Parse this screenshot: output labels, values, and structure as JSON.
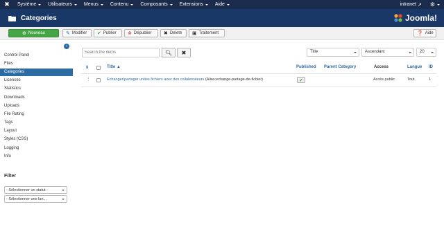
{
  "navbar": {
    "logo": "joomla-icon",
    "menus": [
      "Système",
      "Utilisateurs",
      "Menus",
      "Contenu",
      "Composants",
      "Extensions",
      "Aide"
    ],
    "right": {
      "user": "intranet",
      "settings_icon": "gear-icon"
    }
  },
  "header": {
    "title": "Categories",
    "brand": "Joomla!"
  },
  "toolbar": {
    "new": "Nouveau",
    "edit": "Modifier",
    "publish": "Publier",
    "unpublish": "Dépublier",
    "delete": "Delete",
    "batch": "Traitement",
    "help": "Aide"
  },
  "sidebar": {
    "items": [
      "Control Panel",
      "Files",
      "Categories",
      "Licenses",
      "Statistics",
      "Downloads",
      "Uploads",
      "File Rating",
      "Tags",
      "Layout",
      "Styles (CSS)",
      "Logging",
      "Info"
    ],
    "active_index": 2,
    "filter_title": "Filter",
    "filter_status": "- Sélectionner un statut -",
    "filter_language": "- Sélectionner une lan..."
  },
  "search": {
    "placeholder": "Search the items"
  },
  "list_controls": {
    "order_by": "Title",
    "direction": "Ascendant",
    "limit": "20"
  },
  "table": {
    "headers": {
      "title": "Title",
      "published": "Published",
      "parent": "Parent Category",
      "access": "Access",
      "language": "Langue",
      "id": "ID"
    },
    "rows": [
      {
        "title": "Echanger/partager unites fichiers avec des collaborateurs",
        "alias": "(Alias:echange-partage-de-fichier)",
        "published": true,
        "parent": "",
        "access": "Accès public",
        "language": "Tout",
        "id": "1"
      }
    ]
  },
  "colors": {
    "navbar": "#1b2b4b",
    "header": "#1a3867",
    "accent": "#2d6ca2",
    "new_button": "#46a546"
  }
}
